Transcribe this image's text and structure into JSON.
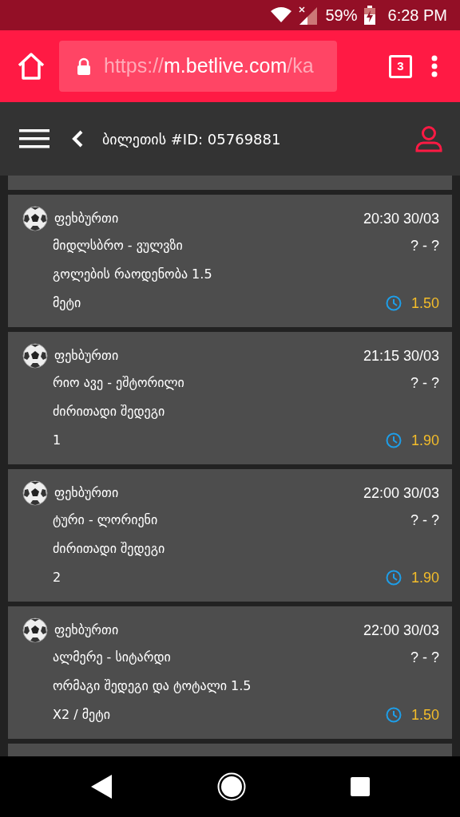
{
  "status_bar": {
    "battery": "59%",
    "time": "6:28 PM"
  },
  "browser": {
    "url": {
      "scheme": "https://",
      "host": "m.betlive.com",
      "path": "/ka"
    },
    "tab_count": "3"
  },
  "header": {
    "title": "ბილეთის #ID: 05769881"
  },
  "bets": [
    {
      "sport": "ფეხბურთი",
      "datetime": "20:30 30/03",
      "match": "მიდლსბრო - ვულვზი",
      "score": "? - ?",
      "market": "გოლების რაოდენობა 1.5",
      "selection": "მეტი",
      "odds": "1.50"
    },
    {
      "sport": "ფეხბურთი",
      "datetime": "21:15 30/03",
      "match": "რიო ავე - ეშტორილი",
      "score": "? - ?",
      "market": "ძირითადი შედეგი",
      "selection": "1",
      "odds": "1.90"
    },
    {
      "sport": "ფეხბურთი",
      "datetime": "22:00 30/03",
      "match": "ტური - ლორიენი",
      "score": "? - ?",
      "market": "ძირითადი შედეგი",
      "selection": "2",
      "odds": "1.90"
    },
    {
      "sport": "ფეხბურთი",
      "datetime": "22:00 30/03",
      "match": "ალმერე - სიტარდი",
      "score": "? - ?",
      "market": "ორმაგი შედეგი და ტოტალი 1.5",
      "selection": "X2 / მეტი",
      "odds": "1.50"
    }
  ]
}
